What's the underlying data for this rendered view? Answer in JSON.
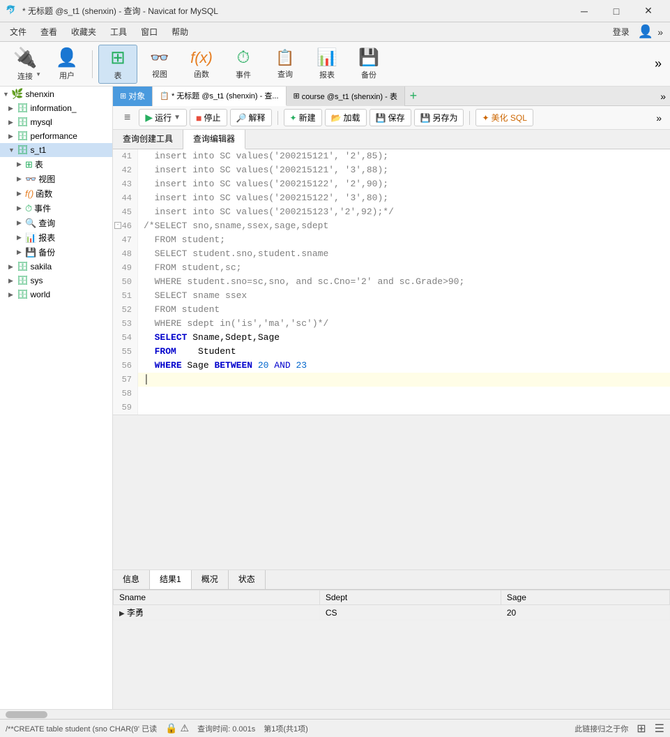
{
  "titleBar": {
    "title": "* 无标题 @s_t1 (shenxin) - 查询 - Navicat for MySQL",
    "modified": "*",
    "windowControls": {
      "minimize": "─",
      "maximize": "□",
      "close": "✕"
    }
  },
  "menuBar": {
    "items": [
      "文件",
      "查看",
      "收藏夹",
      "工具",
      "窗口",
      "帮助"
    ],
    "loginLabel": "登录",
    "expandLabel": "»"
  },
  "toolbar": {
    "connect": "连接",
    "user": "用户",
    "table": "表",
    "view": "视图",
    "function": "函数",
    "event": "事件",
    "query": "查询",
    "report": "报表",
    "backup": "备份"
  },
  "sidebar": {
    "rootLabel": "shenxin",
    "databases": [
      {
        "name": "information_",
        "level": 1,
        "expanded": false
      },
      {
        "name": "mysql",
        "level": 1,
        "expanded": false
      },
      {
        "name": "performance",
        "level": 1,
        "expanded": false
      },
      {
        "name": "s_t1",
        "level": 1,
        "expanded": true,
        "children": [
          {
            "name": "表",
            "type": "table",
            "expanded": false
          },
          {
            "name": "视图",
            "type": "view",
            "expanded": false
          },
          {
            "name": "函数",
            "type": "func",
            "expanded": false
          },
          {
            "name": "事件",
            "type": "event",
            "expanded": false
          },
          {
            "name": "查询",
            "type": "query",
            "expanded": false
          },
          {
            "name": "报表",
            "type": "report",
            "expanded": false
          },
          {
            "name": "备份",
            "type": "backup",
            "expanded": false
          }
        ]
      },
      {
        "name": "sakila",
        "level": 1,
        "expanded": false
      },
      {
        "name": "sys",
        "level": 1,
        "expanded": false
      },
      {
        "name": "world",
        "level": 1,
        "expanded": false
      }
    ]
  },
  "tabs": {
    "objectTab": "对象",
    "queryTab1": "* 无标题 @s_t1 (shenxin) - 查...",
    "queryTab2": "course @s_t1 (shenxin) - 表"
  },
  "queryToolbar": {
    "hamburger": "≡",
    "run": "▶ 运行",
    "runDropdown": "▼",
    "stop": "■ 停止",
    "explain": "解释",
    "new": "新建",
    "load": "加载",
    "save": "保存",
    "saveAs": "另存为",
    "beautify": "美化 SQL"
  },
  "querySubtabs": {
    "tabs": [
      "查询创建工具",
      "查询编辑器"
    ]
  },
  "codeLines": [
    {
      "num": 41,
      "content": "  insert into SC values('200215121', '2',85);",
      "type": "normal"
    },
    {
      "num": 42,
      "content": "  insert into SC values('200215121', '3',88);",
      "type": "normal"
    },
    {
      "num": 43,
      "content": "  insert into SC values('200215122', '2',90);",
      "type": "normal"
    },
    {
      "num": 44,
      "content": "  insert into SC values('200215122', '3',80);",
      "type": "normal"
    },
    {
      "num": 45,
      "content": "  insert into SC values('200215123','2',92);*/",
      "type": "normal"
    },
    {
      "num": 46,
      "content": "/*SELECT sno,sname,ssex,sage,sdept",
      "type": "comment",
      "hasCollapse": true
    },
    {
      "num": 47,
      "content": "  FROM student;",
      "type": "comment"
    },
    {
      "num": 48,
      "content": "  SELECT student.sno,student.sname",
      "type": "comment"
    },
    {
      "num": 49,
      "content": "  FROM student,sc;",
      "type": "comment"
    },
    {
      "num": 50,
      "content": "  WHERE student.sno=sc,sno, and sc.Cno='2' and sc.Grade>90;",
      "type": "comment"
    },
    {
      "num": 51,
      "content": "  SELECT sname ssex",
      "type": "comment"
    },
    {
      "num": 52,
      "content": "  FROM student",
      "type": "comment"
    },
    {
      "num": 53,
      "content": "  WHERE sdept in('is','ma','sc')*/",
      "type": "comment"
    },
    {
      "num": 54,
      "content": "  SELECT Sname,Sdept,Sage",
      "type": "sql"
    },
    {
      "num": 55,
      "content": "  FROM    Student",
      "type": "sql"
    },
    {
      "num": 56,
      "content": "  WHERE Sage BETWEEN 20 AND 23",
      "type": "sql"
    },
    {
      "num": 57,
      "content": "",
      "type": "cursor"
    },
    {
      "num": 58,
      "content": "",
      "type": "normal"
    },
    {
      "num": 59,
      "content": "",
      "type": "normal"
    }
  ],
  "resultPanel": {
    "tabs": [
      "信息",
      "结果1",
      "概况",
      "状态"
    ],
    "activeTab": "结果1",
    "columns": [
      "Sname",
      "Sdept",
      "Sage"
    ],
    "rows": [
      {
        "cells": [
          "李勇",
          "CS",
          "20"
        ]
      }
    ]
  },
  "statusBar": {
    "sql": "/**CREATE table student (sno CHAR(9'  已读",
    "queryTime": "查询时间: 0.001s",
    "pageInfo": "第1项(共1项)",
    "tip": "此链接归之于你"
  }
}
